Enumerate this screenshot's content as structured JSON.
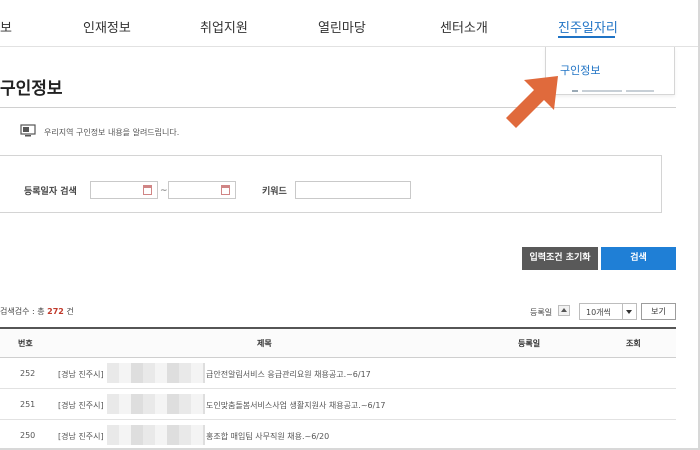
{
  "nav": {
    "items": [
      {
        "label": "보"
      },
      {
        "label": "인재정보"
      },
      {
        "label": "취업지원"
      },
      {
        "label": "열린마당"
      },
      {
        "label": "센터소개"
      },
      {
        "label": "진주일자리"
      }
    ],
    "active_index": 5,
    "dropdown_item": "구인정보"
  },
  "page": {
    "title": "구인정보",
    "notice": "우리지역 구인정보 내용을 알려드립니다."
  },
  "search": {
    "date_label": "등록일자 검색",
    "date_sep": "~",
    "keyword_label": "키워드",
    "date_from": "",
    "date_to": "",
    "keyword": ""
  },
  "buttons": {
    "reset": "입력조건 초기화",
    "search": "검색",
    "view": "보기"
  },
  "results": {
    "count_prefix": "검색검수 : 총",
    "count": "272",
    "count_suffix": "건",
    "sort_label": "등록일",
    "page_size": "10개씩"
  },
  "table": {
    "headers": [
      "번호",
      "제목",
      "등록일",
      "조회"
    ],
    "rows": [
      {
        "no": "252",
        "prefix": "[경남 진주시]",
        "title": "급안전알림서비스 응급관리요원 채용공고.~6/17"
      },
      {
        "no": "251",
        "prefix": "[경남 진주시]",
        "title": "도인맞춤돌봄서비스사업 생활지원사 채용공고.~6/17"
      },
      {
        "no": "250",
        "prefix": "[경남 진주시]",
        "title": "홍조합 매입팀 사무직원 채용.~6/20"
      }
    ]
  },
  "colors": {
    "accent": "#1f73c5",
    "search_button": "#1f7fd6",
    "reset_button": "#595959",
    "arrow": "#e06a3c",
    "count_highlight": "#c0392b"
  }
}
